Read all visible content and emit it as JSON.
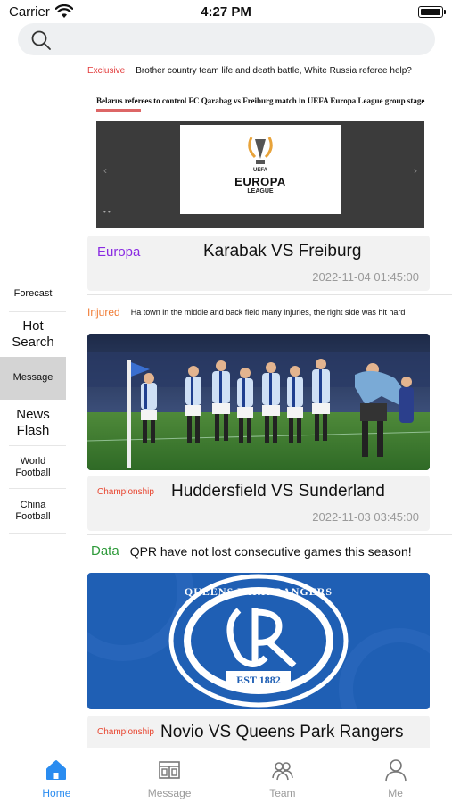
{
  "status": {
    "carrier": "Carrier",
    "time": "4:27 PM"
  },
  "search": {
    "placeholder": ""
  },
  "sidebar": {
    "items": [
      {
        "label": "Forecast"
      },
      {
        "label": "Hot Search"
      },
      {
        "label": "Message"
      },
      {
        "label": "News Flash"
      },
      {
        "label": "World Football"
      },
      {
        "label": "China Football"
      }
    ]
  },
  "feed": {
    "items": [
      {
        "tag": "Exclusive",
        "tag_color": "#e23b3b",
        "headline": "Brother country team life and death battle, White Russia referee help?",
        "image_caption": "Belarus referees to control FC Qarabag vs Freiburg match in UEFA Europa League group stage",
        "image_logo_top": "UEFA",
        "image_logo_main": "EUROPA",
        "image_logo_sub": "LEAGUE",
        "league": "Europa",
        "league_color": "#8a2be2",
        "match": "Karabak VS Freiburg",
        "time": "2022-11-04 01:45:00"
      },
      {
        "tag": "Injured",
        "tag_color": "#f07c35",
        "headline": "Ha town in the middle and back field many injuries, the right side was hit hard",
        "league": "Championship",
        "league_color": "#e8452f",
        "match": "Huddersfield VS Sunderland",
        "time": "2022-11-03 03:45:00"
      },
      {
        "tag": "Data",
        "tag_color": "#2e9a3a",
        "headline": "QPR have not lost consecutive games this season!",
        "image_crest_top": "QUEENS PARK RANGERS",
        "image_crest_main": "QPR",
        "image_crest_bottom": "EST 1882",
        "league": "Championship",
        "league_color": "#e8452f",
        "match": "Novio VS Queens Park Rangers"
      }
    ]
  },
  "tabbar": {
    "active_color": "#2a8cf0",
    "items": [
      {
        "label": "Home",
        "icon": "home-icon"
      },
      {
        "label": "Message",
        "icon": "message-icon"
      },
      {
        "label": "Team",
        "icon": "team-icon"
      },
      {
        "label": "Me",
        "icon": "me-icon"
      }
    ]
  }
}
